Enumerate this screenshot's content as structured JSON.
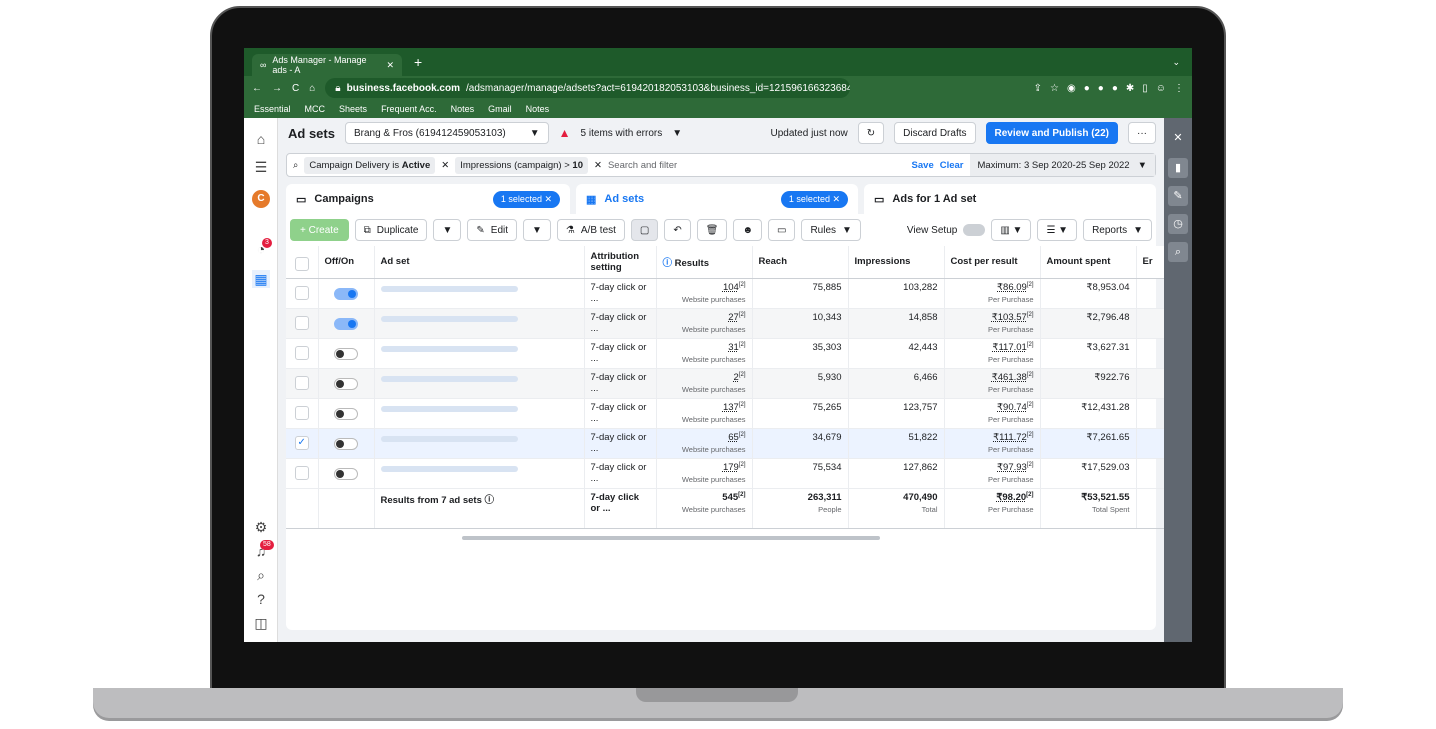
{
  "browser": {
    "tab_title": "Ads Manager - Manage ads - A",
    "url_domain": "business.facebook.com",
    "url_path": "/adsmanager/manage/adsets?act=619420182053103&business_id=121596166323684&gl...",
    "bookmarks": [
      "Essential",
      "MCC",
      "Sheets",
      "Frequent Acc.",
      "Notes",
      "Gmail",
      "Notes"
    ]
  },
  "topbar": {
    "title": "Ad sets",
    "account": "Brang & Fros (619412459053103)",
    "errors": "5 items with errors",
    "updated": "Updated just now",
    "discard": "Discard Drafts",
    "publish": "Review and Publish (22)",
    "more": "···"
  },
  "filters": {
    "chip1_prefix": "Campaign Delivery is ",
    "chip1_bold": "Active",
    "chip2_prefix": "Impressions (campaign) > ",
    "chip2_bold": "10",
    "placeholder": "Search and filter",
    "save": "Save",
    "clear": "Clear",
    "date": "Maximum: 3 Sep 2020-25 Sep 2022"
  },
  "panels": {
    "campaigns": "Campaigns",
    "campaigns_sel": "1 selected",
    "adsets": "Ad sets",
    "adsets_sel": "1 selected",
    "ads": "Ads for 1 Ad set"
  },
  "toolbar": {
    "create": "Create",
    "duplicate": "Duplicate",
    "edit": "Edit",
    "abtest": "A/B test",
    "rules": "Rules",
    "view_setup": "View Setup",
    "reports": "Reports"
  },
  "columns": {
    "offon": "Off/On",
    "adset": "Ad set",
    "attribution": "Attribution setting",
    "results": "Results",
    "reach": "Reach",
    "impressions": "Impressions",
    "cpr": "Cost per result",
    "amount": "Amount spent",
    "extra": "Er"
  },
  "rows": [
    {
      "attr": "7-day click or ...",
      "results": "104",
      "res_sub": "Website purchases",
      "reach": "75,885",
      "impr": "103,282",
      "cpr": "₹86.09",
      "cpr_sub": "Per Purchase",
      "amount": "₹8,953.04"
    },
    {
      "attr": "7-day click or ...",
      "results": "27",
      "res_sub": "Website purchases",
      "reach": "10,343",
      "impr": "14,858",
      "cpr": "₹103.57",
      "cpr_sub": "Per Purchase",
      "amount": "₹2,796.48"
    },
    {
      "attr": "7-day click or ...",
      "results": "31",
      "res_sub": "Website purchases",
      "reach": "35,303",
      "impr": "42,443",
      "cpr": "₹117.01",
      "cpr_sub": "Per Purchase",
      "amount": "₹3,627.31"
    },
    {
      "attr": "7-day click or ...",
      "results": "2",
      "res_sub": "Website purchases",
      "reach": "5,930",
      "impr": "6,466",
      "cpr": "₹461.38",
      "cpr_sub": "Per Purchase",
      "amount": "₹922.76"
    },
    {
      "attr": "7-day click or ...",
      "results": "137",
      "res_sub": "Website purchases",
      "reach": "75,265",
      "impr": "123,757",
      "cpr": "₹90.74",
      "cpr_sub": "Per Purchase",
      "amount": "₹12,431.28"
    },
    {
      "attr": "7-day click or ...",
      "results": "65",
      "res_sub": "Website purchases",
      "reach": "34,679",
      "impr": "51,822",
      "cpr": "₹111.72",
      "cpr_sub": "Per Purchase",
      "amount": "₹7,261.65"
    },
    {
      "attr": "7-day click or ...",
      "results": "179",
      "res_sub": "Website purchases",
      "reach": "75,534",
      "impr": "127,862",
      "cpr": "₹97.93",
      "cpr_sub": "Per Purchase",
      "amount": "₹17,529.03"
    }
  ],
  "totals": {
    "label": "Results from 7 ad sets",
    "attr": "7-day click or ...",
    "results": "545",
    "res_sub": "Website purchases",
    "reach": "263,311",
    "reach_sub": "People",
    "impr": "470,490",
    "impr_sub": "Total",
    "cpr": "₹98.20",
    "cpr_sub": "Per Purchase",
    "amount": "₹53,521.55",
    "amount_sub": "Total Spent"
  },
  "badges": {
    "notif": "3",
    "alerts": "58"
  },
  "superscript": "[2]",
  "avatar": "C"
}
